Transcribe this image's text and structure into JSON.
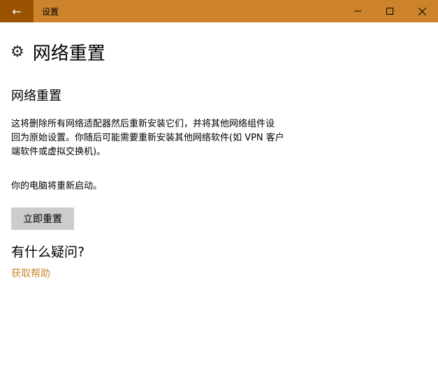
{
  "window": {
    "title": "设置",
    "back_icon": "←",
    "min_icon": "—",
    "max_icon": "☐",
    "close_icon": "✕"
  },
  "page": {
    "title": "网络重置",
    "icon": "⚙"
  },
  "section": {
    "title": "网络重置",
    "description_lines": [
      "这将删除所有网络适配器然后重新安装它们，并将其他网络组件设",
      "回为原始设置。你随后可能需要重新安装其他网络软件(如 VPN 客户",
      "端软件或虚拟交换机)。"
    ],
    "restart_note": "你的电脑将重新启动。",
    "reset_button": "立即重置"
  },
  "help": {
    "title": "有什么疑问?",
    "link": "获取帮助"
  },
  "colors": {
    "titlebar": "#cc832c",
    "back": "#9a5300",
    "link": "#cb8a35"
  }
}
